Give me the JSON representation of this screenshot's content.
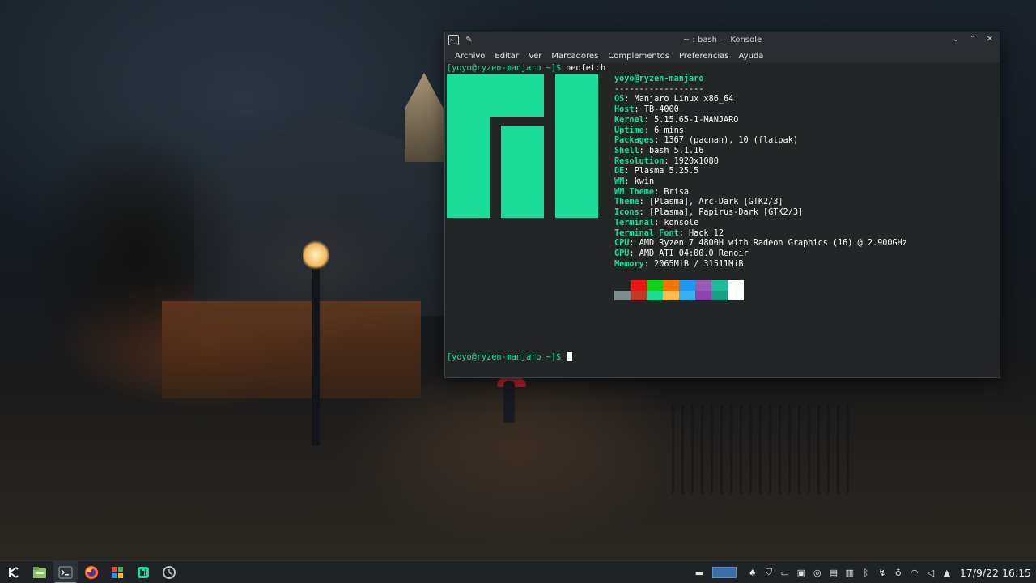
{
  "window": {
    "title": "~ : bash — Konsole",
    "menu": [
      "Archivo",
      "Editar",
      "Ver",
      "Marcadores",
      "Complementos",
      "Preferencias",
      "Ayuda"
    ]
  },
  "terminal": {
    "prompt": "[yoyo@ryzen-manjaro ~]$",
    "command": "neofetch",
    "user_host": "yoyo@ryzen-manjaro",
    "separator": "------------------",
    "info": [
      {
        "label": "OS",
        "value": "Manjaro Linux x86_64"
      },
      {
        "label": "Host",
        "value": "TB-4000"
      },
      {
        "label": "Kernel",
        "value": "5.15.65-1-MANJARO"
      },
      {
        "label": "Uptime",
        "value": "6 mins"
      },
      {
        "label": "Packages",
        "value": "1367 (pacman), 10 (flatpak)"
      },
      {
        "label": "Shell",
        "value": "bash 5.1.16"
      },
      {
        "label": "Resolution",
        "value": "1920x1080"
      },
      {
        "label": "DE",
        "value": "Plasma 5.25.5"
      },
      {
        "label": "WM",
        "value": "kwin"
      },
      {
        "label": "WM Theme",
        "value": "Brisa"
      },
      {
        "label": "Theme",
        "value": "[Plasma], Arc-Dark [GTK2/3]"
      },
      {
        "label": "Icons",
        "value": "[Plasma], Papirus-Dark [GTK2/3]"
      },
      {
        "label": "Terminal",
        "value": "konsole"
      },
      {
        "label": "Terminal Font",
        "value": "Hack 12"
      },
      {
        "label": "CPU",
        "value": "AMD Ryzen 7 4800H with Radeon Graphics (16) @ 2.900GHz"
      },
      {
        "label": "GPU",
        "value": "AMD ATI 04:00.0 Renoir"
      },
      {
        "label": "Memory",
        "value": "2065MiB / 31511MiB"
      }
    ],
    "palette_top": [
      "#232627",
      "#ed1515",
      "#11d116",
      "#f67400",
      "#1d99f3",
      "#9b59b6",
      "#1abc9c",
      "#fcfcfc"
    ],
    "palette_bottom": [
      "#7f8c8d",
      "#c0392b",
      "#1cdc9a",
      "#fdbc4b",
      "#3daee9",
      "#8e44ad",
      "#16a085",
      "#ffffff"
    ],
    "logo_color": "#1cdc9a"
  },
  "taskbar": {
    "apps": [
      {
        "name": "app-launcher-icon",
        "glyph": "✲"
      },
      {
        "name": "file-manager-icon",
        "glyph": "▬"
      },
      {
        "name": "terminal-icon",
        "glyph": ">_"
      },
      {
        "name": "firefox-icon",
        "glyph": "●"
      },
      {
        "name": "software-center-icon",
        "glyph": "▦"
      },
      {
        "name": "manjaro-hello-icon",
        "glyph": "♆"
      },
      {
        "name": "timeshift-icon",
        "glyph": "◷"
      }
    ],
    "clock": "17/9/22 16:15"
  },
  "colors": {
    "accent": "#1cdc9a",
    "taskbar_bg": "#1f2326",
    "window_bg": "#232627"
  }
}
